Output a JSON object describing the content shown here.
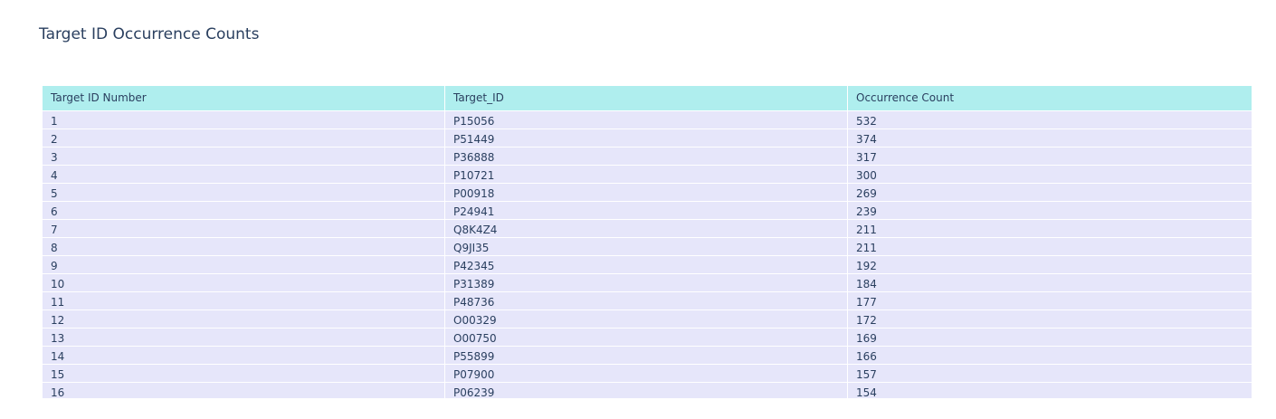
{
  "chart_data": {
    "type": "table",
    "title": "Target ID Occurrence Counts",
    "columns": [
      "Target ID Number",
      "Target_ID",
      "Occurrence Count"
    ],
    "rows": [
      [
        "1",
        "P15056",
        "532"
      ],
      [
        "2",
        "P51449",
        "374"
      ],
      [
        "3",
        "P36888",
        "317"
      ],
      [
        "4",
        "P10721",
        "300"
      ],
      [
        "5",
        "P00918",
        "269"
      ],
      [
        "6",
        "P24941",
        "239"
      ],
      [
        "7",
        "Q8K4Z4",
        "211"
      ],
      [
        "8",
        "Q9JI35",
        "211"
      ],
      [
        "9",
        "P42345",
        "192"
      ],
      [
        "10",
        "P31389",
        "184"
      ],
      [
        "11",
        "P48736",
        "177"
      ],
      [
        "12",
        "O00329",
        "172"
      ],
      [
        "13",
        "O00750",
        "169"
      ],
      [
        "14",
        "P55899",
        "166"
      ],
      [
        "15",
        "P07900",
        "157"
      ],
      [
        "16",
        "P06239",
        "154"
      ]
    ],
    "colors": {
      "header_fill": "#afeeee",
      "cell_fill": "#e6e6fa",
      "text": "#2a3f5f"
    }
  }
}
